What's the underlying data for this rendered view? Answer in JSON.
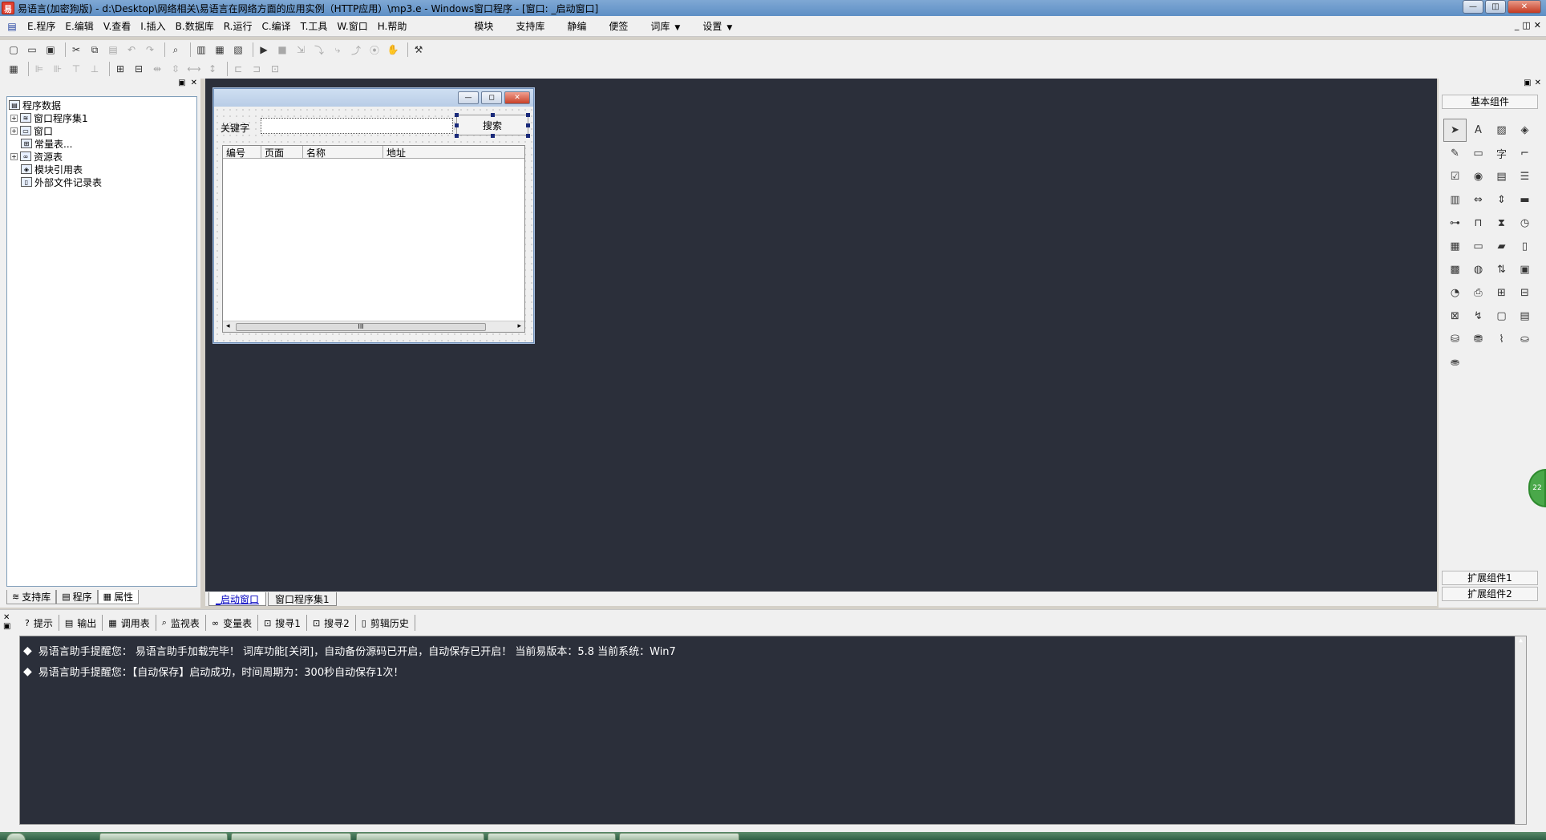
{
  "window": {
    "title": "易语言(加密狗版) - d:\\Desktop\\网络相关\\易语言在网络方面的应用实例（HTTP应用）\\mp3.e - Windows窗口程序 - [窗口: _启动窗口]",
    "minimize": "—",
    "restore": "◫",
    "close": "✕"
  },
  "menu": {
    "items": [
      "E.程序",
      "E.编辑",
      "V.查看",
      "I.插入",
      "B.数据库",
      "R.运行",
      "C.编译",
      "T.工具",
      "W.窗口",
      "H.帮助"
    ],
    "right_items": [
      "模块",
      "支持库",
      "静编",
      "便签",
      "词库",
      "设置"
    ],
    "mdi_min": "_",
    "mdi_restore": "◫",
    "mdi_close": "✕"
  },
  "left_panel": {
    "pin": "▣",
    "close": "✕",
    "tree": {
      "root": "程序数据",
      "items": [
        "窗口程序集1",
        "窗口",
        "常量表...",
        "资源表",
        "模块引用表",
        "外部文件记录表"
      ]
    },
    "tabs": [
      "支持库",
      "程序",
      "属性"
    ]
  },
  "form": {
    "keyword_label": "关键字",
    "search_button": "搜索",
    "columns": [
      "编号",
      "页面",
      "名称",
      "地址"
    ],
    "scroll_grip": "III"
  },
  "center_tabs": [
    "_启动窗口",
    "窗口程序集1"
  ],
  "right_panel": {
    "pin": "▣",
    "close": "✕",
    "header": "基本组件",
    "ext1": "扩展组件1",
    "ext2": "扩展组件2",
    "bubble": "22"
  },
  "bottom_panel": {
    "close": "✕",
    "pin": "▣",
    "tabs": [
      "提示",
      "输出",
      "调用表",
      "监视表",
      "变量表",
      "搜寻1",
      "搜寻2",
      "剪辑历史"
    ],
    "lines": [
      "易语言助手提醒您：  易语言助手加载完毕！ 词库功能[关闭]，自动备份源码已开启，自动保存已开启！  当前易版本：5.8  当前系统：Win7",
      "易语言助手提醒您：【自动保存】启动成功，时间周期为：300秒自动保存1次！"
    ]
  }
}
